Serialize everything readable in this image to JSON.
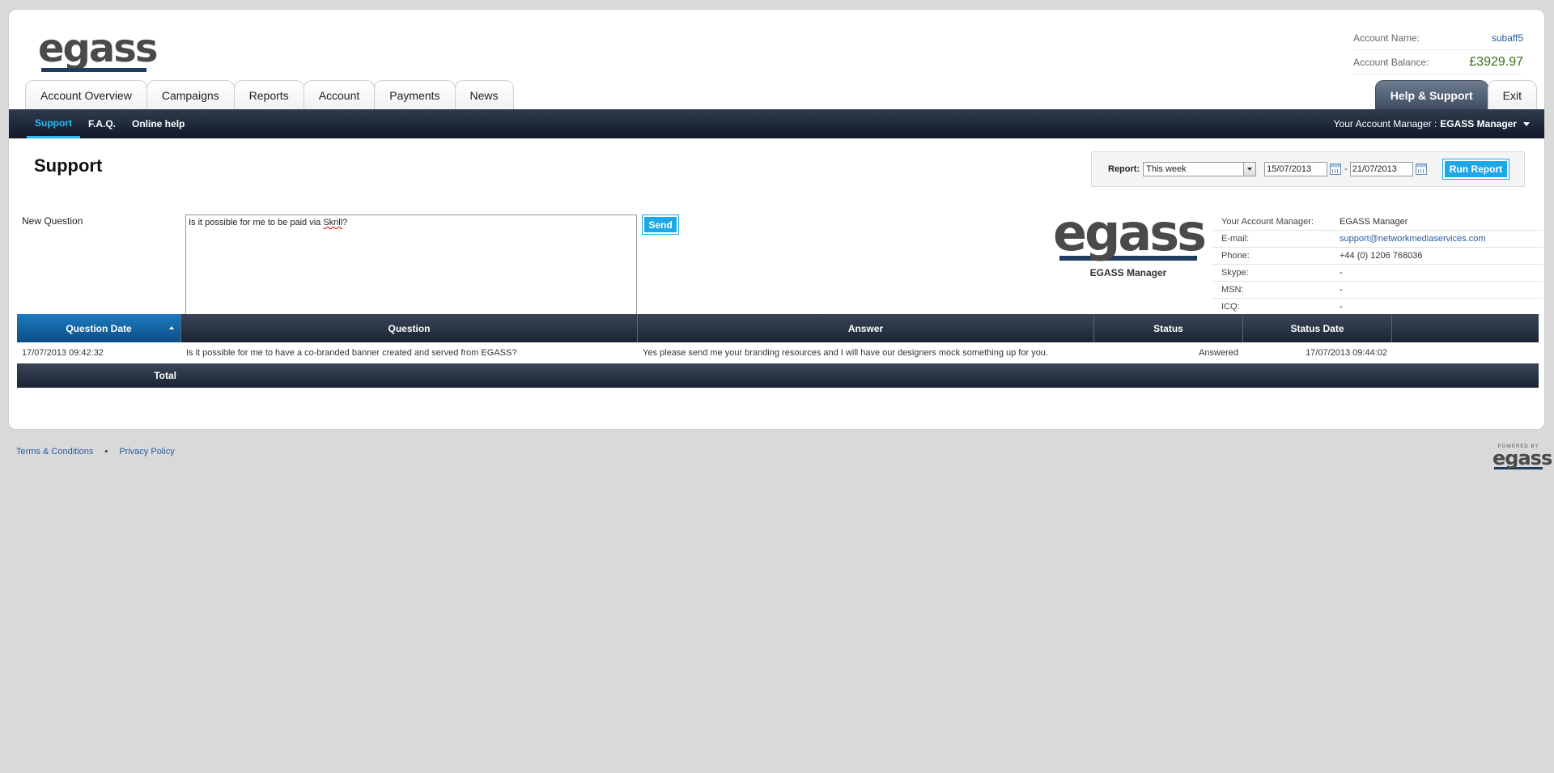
{
  "brand": {
    "logo_text": "egass",
    "accent": "#1fa8e6",
    "nav_dark": "#11192a"
  },
  "account": {
    "name_label": "Account Name:",
    "name_value": "subaff5",
    "balance_label": "Account Balance:",
    "balance_value": "£3929.97"
  },
  "tabs": [
    "Account Overview",
    "Campaigns",
    "Reports",
    "Account",
    "Payments",
    "News"
  ],
  "tabs_right": [
    "Help & Support",
    "Exit"
  ],
  "subnav": [
    "Support",
    "F.A.Q.",
    "Online help"
  ],
  "account_manager_menu": {
    "label": "Your Account Manager :",
    "name": "EGASS Manager"
  },
  "page_title": "Support",
  "report": {
    "label": "Report:",
    "selected": "This week",
    "from": "15/07/2013",
    "dash": "-",
    "to": "21/07/2013",
    "run_label": "Run Report"
  },
  "new_question": {
    "label": "New Question",
    "text_before": "Is it possible for me to be paid via ",
    "text_misspelled": "Skrill",
    "text_after": "?",
    "send_label": "Send"
  },
  "manager_card": {
    "logo_text": "egass",
    "caption": "EGASS Manager",
    "rows": [
      {
        "k": "Your Account Manager:",
        "v": "EGASS Manager"
      },
      {
        "k": "E-mail:",
        "v": "support@networkmediaservices.com"
      },
      {
        "k": "Phone:",
        "v": "+44 (0) 1206 768036"
      },
      {
        "k": "Skype:",
        "v": "-"
      },
      {
        "k": "MSN:",
        "v": "-"
      },
      {
        "k": "ICQ:",
        "v": "-"
      }
    ]
  },
  "table": {
    "headers": [
      "Question Date",
      "Question",
      "Answer",
      "Status",
      "Status Date",
      ""
    ],
    "rows": [
      {
        "date": "17/07/2013 09:42:32",
        "question": "Is it possible for me to have a co-branded banner created and served from EGASS?",
        "answer": "Yes please send me your branding resources and I will have our designers mock something up for you.",
        "status": "Answered",
        "status_date": "17/07/2013 09:44:02"
      }
    ],
    "total_label": "Total"
  },
  "footer": {
    "links": [
      "Terms & Conditions",
      "Privacy Policy"
    ],
    "separator": "•",
    "powered_small": "POWERED BY",
    "powered_logo": "egass"
  }
}
